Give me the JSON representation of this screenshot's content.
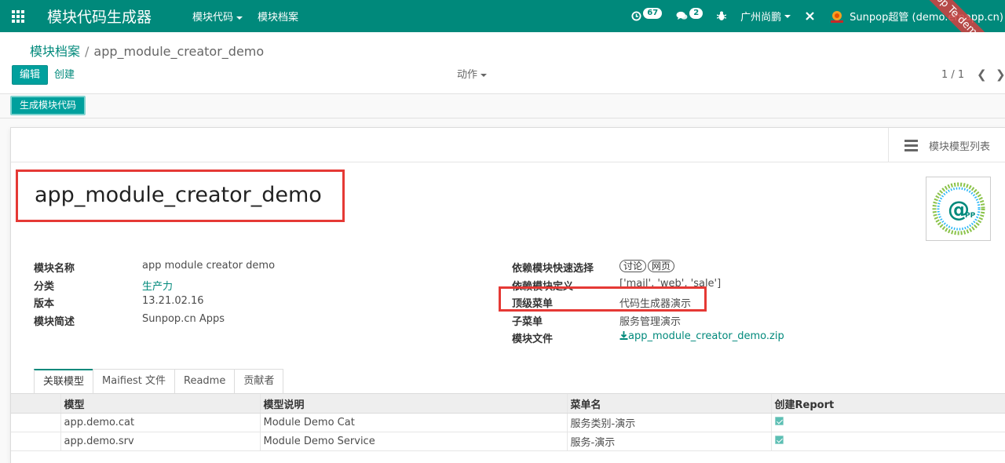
{
  "navbar": {
    "brand": "模块代码生成器",
    "menus": [
      "模块代码",
      "模块档案"
    ],
    "activity_count": "67",
    "message_count": "2",
    "company": "广州尚鹏",
    "user": "Sunpop超管 (demo.erpapp.cn)",
    "ribbon": "Sunpop Te demo.erpapp.c"
  },
  "breadcrumb": {
    "parent": "模块档案",
    "current": "app_module_creator_demo"
  },
  "control": {
    "edit_label": "编辑",
    "create_label": "创建",
    "actions_label": "动作",
    "pager": "1 / 1"
  },
  "header": {
    "generate_label": "生成模块代码"
  },
  "smart_button": {
    "label": "模块模型列表"
  },
  "record": {
    "title": "app_module_creator_demo"
  },
  "left_fields": [
    {
      "label": "模块名称",
      "value": "app module creator demo"
    },
    {
      "label": "分类",
      "value": "生产力"
    },
    {
      "label": "版本",
      "value": "13.21.02.16"
    },
    {
      "label": "模块简述",
      "value": "Sunpop.cn Apps"
    }
  ],
  "right_fields": {
    "dep_quick": {
      "label": "依赖模块快速选择",
      "tags": [
        "讨论",
        "网页"
      ]
    },
    "dep_def": {
      "label": "依赖模块定义",
      "value": "['mail', 'web', 'sale']"
    },
    "top_menu": {
      "label": "顶级菜单",
      "value": "代码生成器演示"
    },
    "sub_menu": {
      "label": "子菜单",
      "value": "服务管理演示"
    },
    "module_file": {
      "label": "模块文件",
      "value": "app_module_creator_demo.zip"
    }
  },
  "tabs": [
    "关联模型",
    "Maifiest 文件",
    "Readme",
    "贡献者"
  ],
  "table": {
    "columns": [
      "模型",
      "模型说明",
      "菜单名",
      "创建Report"
    ],
    "rows": [
      {
        "model": "app.demo.cat",
        "desc": "Module Demo Cat",
        "menu": "服务类别-演示",
        "report": true
      },
      {
        "model": "app.demo.srv",
        "desc": "Module Demo Service",
        "menu": "服务-演示",
        "report": true
      }
    ]
  },
  "colors": {
    "primary": "#00897b",
    "button": "#00a09d",
    "highlight": "#e53935"
  }
}
